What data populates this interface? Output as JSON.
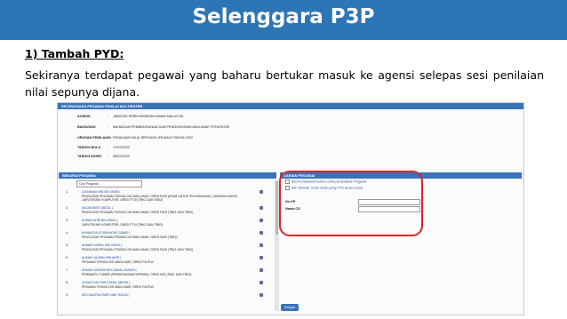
{
  "slide": {
    "title": "Selenggara P3P",
    "heading": "1) Tambah PYD:",
    "paragraph": "Sekiranya terdapat pegawai yang baharu bertukar masuk ke agensi selepas sesi penilaian nilai sepunya dijana.",
    "accent_color": "#2e75b6",
    "highlight_color": "#d9232d"
  },
  "app": {
    "header_bar": "SELENGGARA PEGAWAI PENILAI MULTIRATER",
    "info": [
      {
        "label": "AGENSI",
        "value": "JABATAN PERKHIDMATAN AWAM MALAYSIA"
      },
      {
        "label": "BAHAGIAN",
        "value": "BAHAGIAN PEMBANGUNAN DAN PENGURUSAN MAKLUMAT STRATEGIK"
      },
      {
        "label": "URUSAN PENILAIAN",
        "value": "PENILAIAN NILAI SEPUNYA JPA BAGI TAHUN 2022"
      },
      {
        "label": "TARIKH MULA",
        "value": "17/02/2022"
      },
      {
        "label": "TARIKH AKHIR",
        "value": "28/02/2022"
      }
    ],
    "left_panel_bar": "SENARAI PEGAWAI",
    "search_value": "Cari Pegawai...",
    "employees": [
      {
        "no": "1.",
        "name": "A RAHMAN BIN MD YASIN (",
        "desc": "PENOLONG PEGAWAI TEKNOLOGI MAKLUMAT, GRED FA29 (KHAS UNTUK PENYANDANG), JAWATAN HAKIKI JURUTEKNIK KOMPUTER, GRED FT19 (TBK1 DAN TBK2)"
      },
      {
        "no": "2.",
        "name": "ADLAN BINTI ABDUL (",
        "desc": "PENOLONG PEGAWAI TEKNOLOGI MAKLUMAT, GRED FA29 (TBK1 DAN TBK2)"
      },
      {
        "no": "3.",
        "name": "AHMAD ADRI BIN ISHAK (",
        "desc": "JURUTEKNIK KOMPUTER, GRED FT19 (TBK1 DAN TBK2)"
      },
      {
        "no": "4.",
        "name": "AHMAD FAUZI BIN MOHD JABAR (",
        "desc": "PENOLONG PEGAWAI TEKNOLOGI MAKLUMAT, GRED FA32 (TBK2)"
      },
      {
        "no": "5.",
        "name": "AHMAD HAIRAL BIN OMAR (",
        "desc": "PENOLONG PEGAWAI TEKNOLOGI MAKLUMAT, GRED FA29 (TBK1 DAN TBK2)"
      },
      {
        "no": "6.",
        "name": "AHMAD NAJMAL BIN AMIR (",
        "desc": "PEGAWAI TEKNOLOGI MAKLUMAT, GRED F41/F44"
      },
      {
        "no": "7.",
        "name": "AHMAD NAZARN BIN ZAINAL ZAKARI (",
        "desc": "PEMBANTU TADBIR (PERKERANIAN/OPERASI), GRED N19 (TBK1 DAN TBK2)"
      },
      {
        "no": "8.",
        "name": "AHMAD ZAKI BIN ZAINAL ABIDIN (",
        "desc": "PEGAWAI TEKNOLOGI MAKLUMAT, GRED F41/F44"
      },
      {
        "no": "9.",
        "name": "AIDI NAZIRAH BINTI ABD RAZAK (",
        "desc": ""
      }
    ],
    "right_panel_bar": "CARIAN PEGAWAI",
    "checkbox_1": "Sila isi maklumat berikut untuk perpindahan Pegawai",
    "checkbox_2": "Klik 'Tambah' untuk carian yang PYD secara cepat",
    "field_nokp": "No KP",
    "field_nama": "Nama CD",
    "save_button": "Simpan"
  }
}
